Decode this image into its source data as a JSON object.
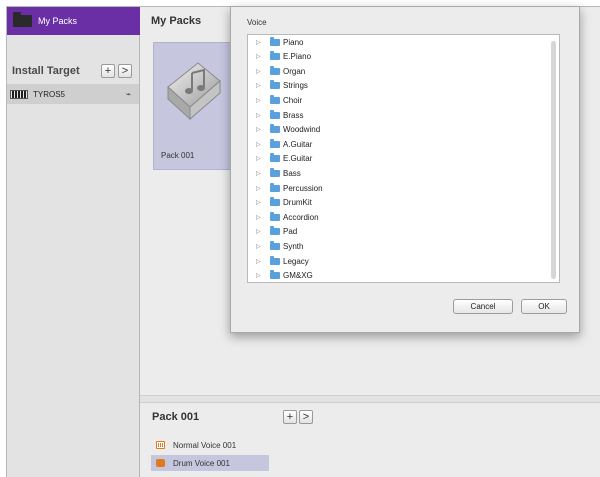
{
  "sidebar": {
    "my_packs_label": "My Packs",
    "install_target_label": "Install Target",
    "add_symbol": "+",
    "arrow_symbol": ">",
    "device_label": "TYROS5",
    "device_status_icon": "wave-icon"
  },
  "main": {
    "title": "My Packs",
    "pack_card_label": "Pack 001"
  },
  "bottom": {
    "title": "Pack 001",
    "add_symbol": "+",
    "arrow_symbol": ">",
    "voices": [
      {
        "label": "Normal Voice 001",
        "icon": "normal-voice-icon"
      },
      {
        "label": "Drum Voice 001",
        "icon": "drum-voice-icon",
        "selected": true
      }
    ]
  },
  "dialog": {
    "title_label": "Voice",
    "items": [
      "Piano",
      "E.Piano",
      "Organ",
      "Strings",
      "Choir",
      "Brass",
      "Woodwind",
      "A.Guitar",
      "E.Guitar",
      "Bass",
      "Percussion",
      "DrumKit",
      "Accordion",
      "Pad",
      "Synth",
      "Legacy",
      "GM&XG"
    ],
    "expand_glyph": "▷",
    "cancel_label": "Cancel",
    "ok_label": "OK"
  },
  "colors": {
    "accent_purple": "#6a2fa4",
    "selection_lavender": "#c6c7de",
    "folder_blue": "#5aa0dd",
    "voice_orange": "#e07a1e"
  }
}
